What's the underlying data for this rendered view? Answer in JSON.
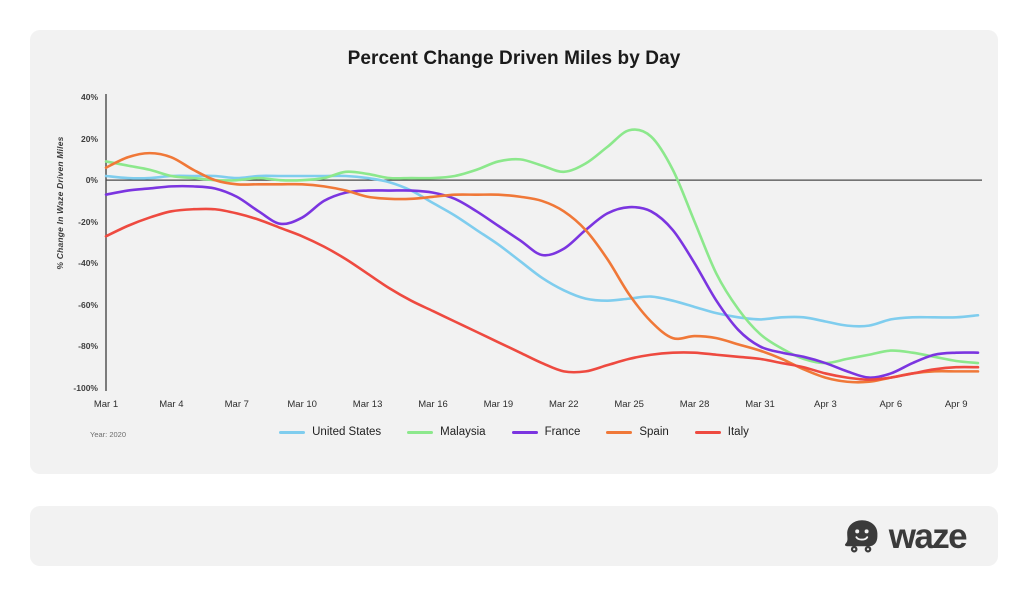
{
  "card": {
    "title": "Percent Change Driven Miles by Day",
    "year_note": "Year: 2020"
  },
  "footer": {
    "logo_word": "waze",
    "logo_icon": "waze-ghost-icon"
  },
  "axes": {
    "y_label": "% Change In Waze Driven Miles",
    "y_ticks": [
      "40%",
      "20%",
      "0%",
      "-20%",
      "-40%",
      "-60%",
      "-80%",
      "-100%"
    ],
    "x_ticks": [
      "Mar 1",
      "Mar 4",
      "Mar 7",
      "Mar 10",
      "Mar 13",
      "Mar 16",
      "Mar 19",
      "Mar 22",
      "Mar 25",
      "Mar 28",
      "Mar 31",
      "Apr 3",
      "Apr 6",
      "Apr 9"
    ]
  },
  "legend": [
    {
      "label": "United States",
      "color": "#7fcdee"
    },
    {
      "label": "Malaysia",
      "color": "#8ce88c"
    },
    {
      "label": "France",
      "color": "#7b35e0"
    },
    {
      "label": "Spain",
      "color": "#f07838"
    },
    {
      "label": "Italy",
      "color": "#ee4a40"
    }
  ],
  "chart_data": {
    "type": "line",
    "title": "Percent Change Driven Miles by Day",
    "xlabel": "",
    "ylabel": "% Change In Waze Driven Miles",
    "ylim": [
      -100,
      40
    ],
    "ytick_step": 20,
    "grid": false,
    "zero_line": true,
    "legend_position": "bottom",
    "annotation": "Year: 2020",
    "x": [
      "Mar 1",
      "Mar 2",
      "Mar 3",
      "Mar 4",
      "Mar 5",
      "Mar 6",
      "Mar 7",
      "Mar 8",
      "Mar 9",
      "Mar 10",
      "Mar 11",
      "Mar 12",
      "Mar 13",
      "Mar 14",
      "Mar 15",
      "Mar 16",
      "Mar 17",
      "Mar 18",
      "Mar 19",
      "Mar 20",
      "Mar 21",
      "Mar 22",
      "Mar 23",
      "Mar 24",
      "Mar 25",
      "Mar 26",
      "Mar 27",
      "Mar 28",
      "Mar 29",
      "Mar 30",
      "Mar 31",
      "Apr 1",
      "Apr 2",
      "Apr 3",
      "Apr 4",
      "Apr 5",
      "Apr 6",
      "Apr 7",
      "Apr 8",
      "Apr 9",
      "Apr 10"
    ],
    "series": [
      {
        "name": "United States",
        "color": "#7fcdee",
        "values": [
          2,
          1,
          1,
          2,
          2,
          2,
          1,
          2,
          2,
          2,
          2,
          2,
          1,
          -1,
          -5,
          -11,
          -17,
          -24,
          -31,
          -39,
          -47,
          -53,
          -57,
          -58,
          -57,
          -56,
          -58,
          -61,
          -64,
          -66,
          -67,
          -66,
          -66,
          -68,
          -70,
          -70,
          -67,
          -66,
          -66,
          -66,
          -65
        ]
      },
      {
        "name": "Malaysia",
        "color": "#8ce88c",
        "values": [
          9,
          7,
          5,
          2,
          1,
          0,
          0,
          1,
          0,
          0,
          1,
          4,
          3,
          1,
          1,
          1,
          2,
          5,
          9,
          10,
          7,
          4,
          8,
          16,
          24,
          21,
          5,
          -20,
          -45,
          -62,
          -74,
          -81,
          -86,
          -88,
          -86,
          -84,
          -82,
          -83,
          -85,
          -87,
          -88
        ]
      },
      {
        "name": "France",
        "color": "#7b35e0",
        "values": [
          -7,
          -5,
          -4,
          -3,
          -3,
          -4,
          -8,
          -15,
          -21,
          -18,
          -10,
          -6,
          -5,
          -5,
          -5,
          -6,
          -9,
          -15,
          -22,
          -29,
          -36,
          -33,
          -24,
          -16,
          -13,
          -15,
          -24,
          -40,
          -58,
          -72,
          -80,
          -83,
          -85,
          -88,
          -92,
          -95,
          -93,
          -88,
          -84,
          -83,
          -83
        ]
      },
      {
        "name": "Spain",
        "color": "#f07838",
        "values": [
          6,
          11,
          13,
          11,
          5,
          0,
          -2,
          -2,
          -2,
          -2,
          -3,
          -5,
          -8,
          -9,
          -9,
          -8,
          -7,
          -7,
          -7,
          -8,
          -10,
          -15,
          -24,
          -38,
          -55,
          -68,
          -76,
          -75,
          -76,
          -79,
          -82,
          -86,
          -91,
          -95,
          -97,
          -97,
          -95,
          -93,
          -92,
          -92,
          -92
        ]
      },
      {
        "name": "Italy",
        "color": "#ee4a40",
        "values": [
          -27,
          -22,
          -18,
          -15,
          -14,
          -14,
          -16,
          -19,
          -23,
          -27,
          -32,
          -38,
          -45,
          -52,
          -58,
          -63,
          -68,
          -73,
          -78,
          -83,
          -88,
          -92,
          -92,
          -89,
          -86,
          -84,
          -83,
          -83,
          -84,
          -85,
          -86,
          -88,
          -90,
          -93,
          -95,
          -96,
          -95,
          -93,
          -91,
          -90,
          -90
        ]
      }
    ],
    "series_end_values": {
      "United States": -65,
      "France": -76,
      "Malaysia": -79,
      "Italy": -84,
      "Spain": -86
    }
  }
}
